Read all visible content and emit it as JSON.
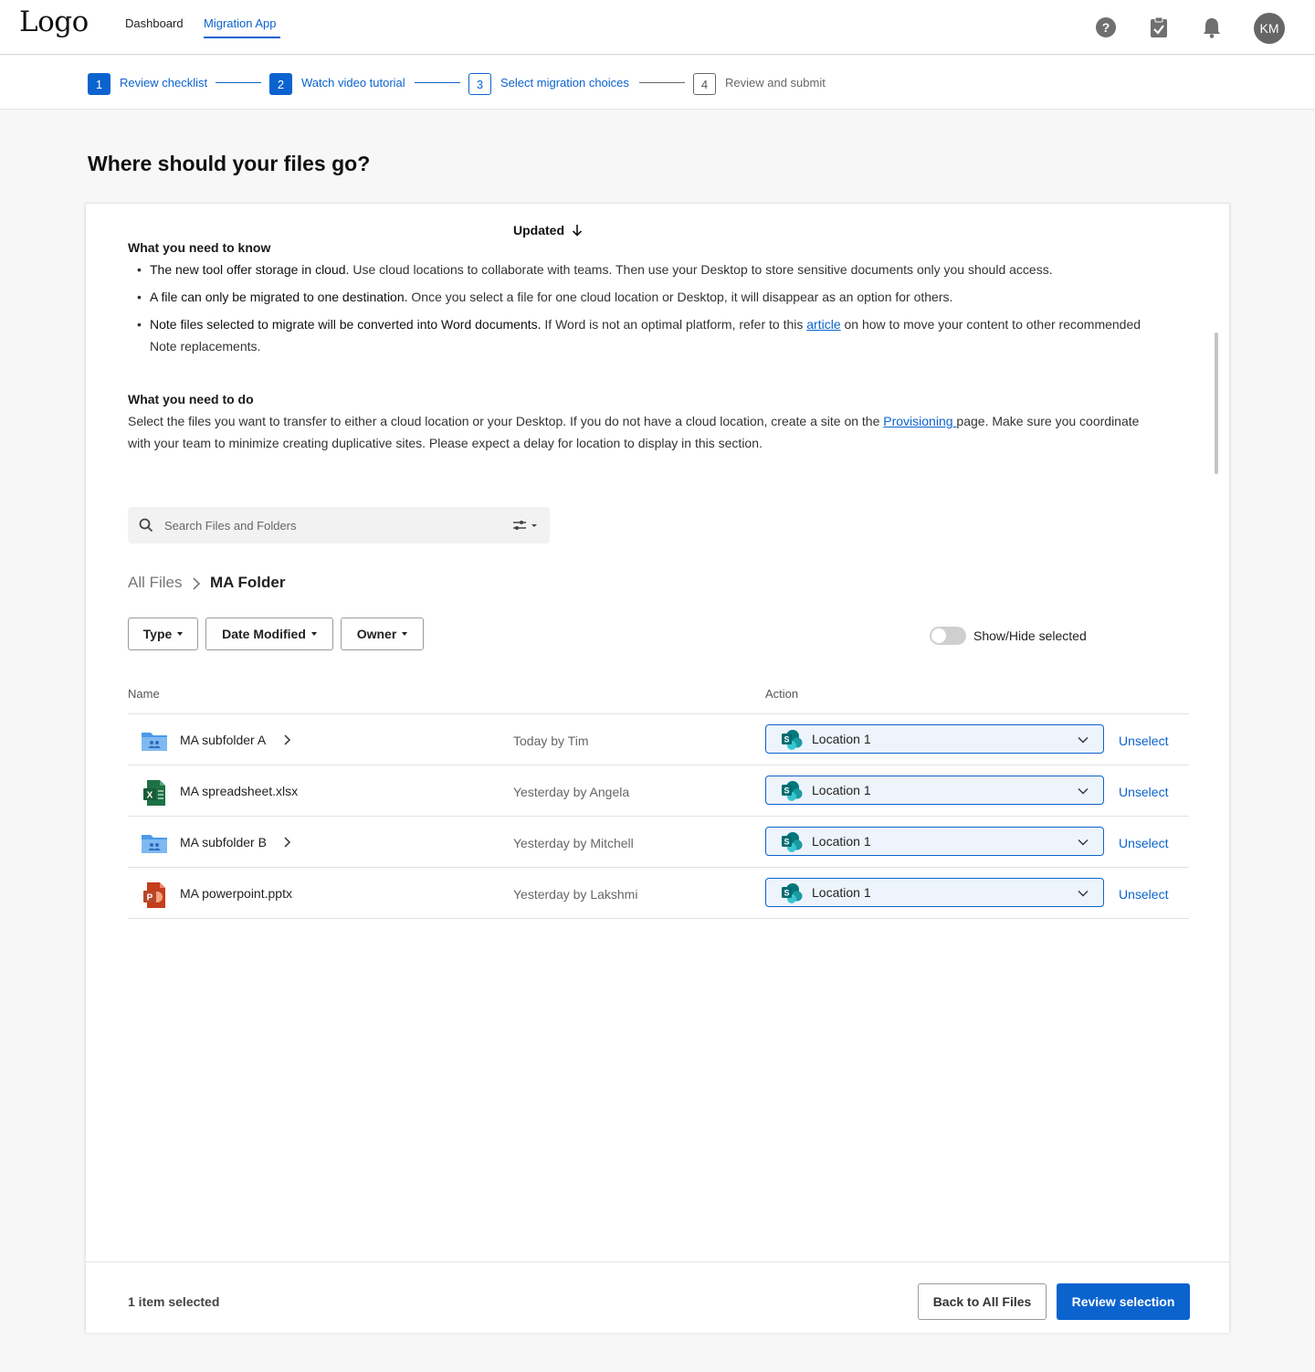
{
  "header": {
    "logo": "Logo",
    "nav": [
      {
        "label": "Dashboard"
      },
      {
        "label": "Migration App",
        "active": true
      }
    ],
    "icons": [
      "help-icon",
      "clipboard-check-icon",
      "bell-icon"
    ],
    "avatar_initials": "KM"
  },
  "stepper": {
    "steps": [
      {
        "number": "1",
        "label": "Review checklist",
        "state": "complete"
      },
      {
        "number": "2",
        "label": "Watch video tutorial",
        "state": "complete"
      },
      {
        "number": "3",
        "label": "Select migration choices",
        "state": "current"
      },
      {
        "number": "4",
        "label": "Review and submit",
        "state": "upcoming"
      }
    ]
  },
  "page": {
    "title": "Where should your files go?"
  },
  "know": {
    "heading": "What you need to know",
    "bullets": [
      {
        "bold": "The new tool offer storage in cloud.",
        "text": " Use cloud locations to collaborate with teams. Then use your Desktop to store sensitive documents only you should access."
      },
      {
        "bold": "A file can only be migrated to one destination.",
        "text": " Once you select a file for one cloud location or Desktop, it will disappear as an option for others."
      },
      {
        "bold": "Note files selected to migrate will be converted into Word documents.",
        "text_before": " If Word is not an optimal platform, refer to this ",
        "link": "article",
        "text_after": " on how to move your content to other recommended Note replacements."
      }
    ]
  },
  "todo": {
    "heading": "What you need to do",
    "text_before": "Select the files you want to transfer to either a cloud location or your Desktop. If you do not have a cloud location, create a site on the ",
    "link": "Provisioning ",
    "text_after": "page. Make sure you coordinate with your team to minimize creating duplicative sites. Please expect a delay for location to display in this section."
  },
  "search": {
    "placeholder": "Search Files and Folders",
    "value": ""
  },
  "breadcrumb": {
    "root": "All Files",
    "current": "MA Folder"
  },
  "filters": [
    {
      "label": "Type"
    },
    {
      "label": "Date Modified"
    },
    {
      "label": "Owner"
    }
  ],
  "toggle": {
    "label": "Show/Hide selected",
    "on": false
  },
  "table": {
    "columns": {
      "name": "Name",
      "updated": "Updated",
      "action": "Action"
    },
    "rows": [
      {
        "name": "MA subfolder A",
        "type": "folder",
        "updated": "Today by Tim",
        "location": "Location 1",
        "action": "Unselect"
      },
      {
        "name": "MA spreadsheet.xlsx",
        "type": "xlsx",
        "updated": "Yesterday by Angela",
        "location": "Location 1",
        "action": "Unselect"
      },
      {
        "name": "MA subfolder B",
        "type": "folder",
        "updated": "Yesterday by Mitchell",
        "location": "Location 1",
        "action": "Unselect"
      },
      {
        "name": "MA powerpoint.pptx",
        "type": "pptx",
        "updated": "Yesterday by Lakshmi",
        "location": "Location 1",
        "action": "Unselect"
      }
    ]
  },
  "footer": {
    "selected_count": "1 item selected",
    "back_label": "Back to All Files",
    "review_label": "Review selection"
  },
  "colors": {
    "accent": "#0b63ce",
    "excel": "#1e7145",
    "powerpoint": "#c43e1c",
    "sharepoint": "#03787c",
    "folder": "#4a9be8"
  }
}
